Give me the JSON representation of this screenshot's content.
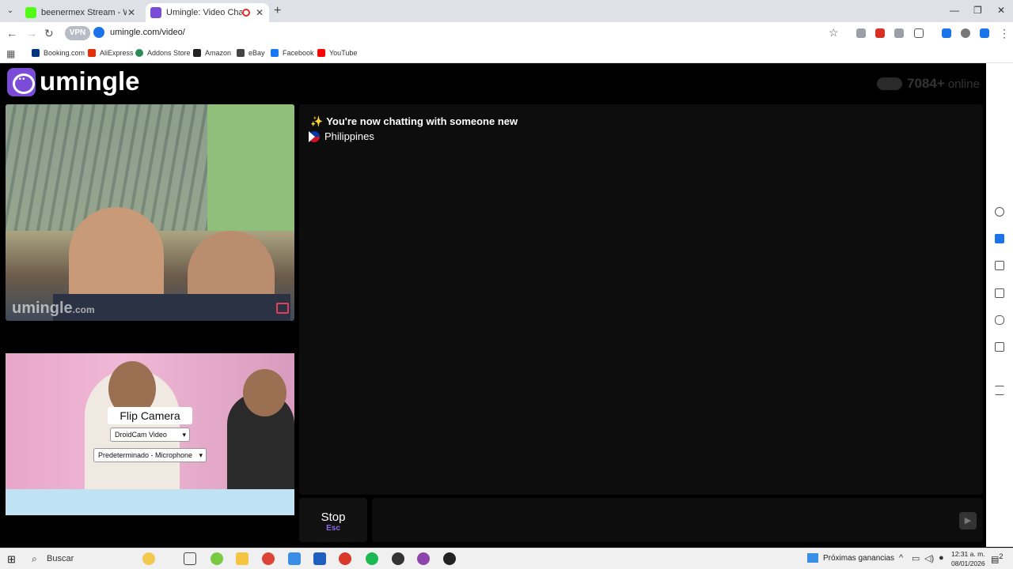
{
  "browser": {
    "tabs": [
      {
        "title": "beenermex Stream - Watch Liv",
        "favicon_color": "#53fc18",
        "active": false
      },
      {
        "title": "Umingle: Video Chat with S",
        "favicon_color": "#7b4cd8",
        "active": true
      }
    ],
    "new_tab_label": "+",
    "url": "umingle.com/video/",
    "vpn_label": "VPN",
    "bookmarks": [
      {
        "label": "Booking.com",
        "color": "#003580"
      },
      {
        "label": "AliExpress",
        "color": "#e62e04"
      },
      {
        "label": "Addons Store",
        "color": "#2e8b57"
      },
      {
        "label": "Amazon",
        "color": "#222222"
      },
      {
        "label": "eBay",
        "color": "#444444"
      },
      {
        "label": "Facebook",
        "color": "#1877f2"
      },
      {
        "label": "YouTube",
        "color": "#ff0000"
      }
    ]
  },
  "page": {
    "logo_text": "umingle",
    "online_count": "7084+",
    "online_label": "online",
    "remote_watermark": "umingle",
    "remote_watermark_suffix": ".com",
    "flip_camera_label": "Flip Camera",
    "camera_select_value": "DroidCam Video",
    "mic_select_value": "Predeterminado - Microphone",
    "chat": {
      "status_message": "You're now chatting with someone new",
      "country": "Philippines"
    },
    "stop_label": "Stop",
    "stop_key": "Esc",
    "accent": "#7b4cd8"
  },
  "taskbar": {
    "search_label": "Buscar",
    "news_label": "Próximas ganancias",
    "time": "12:31 a. m.",
    "date": "08/01/2026",
    "notification_count": "2"
  }
}
